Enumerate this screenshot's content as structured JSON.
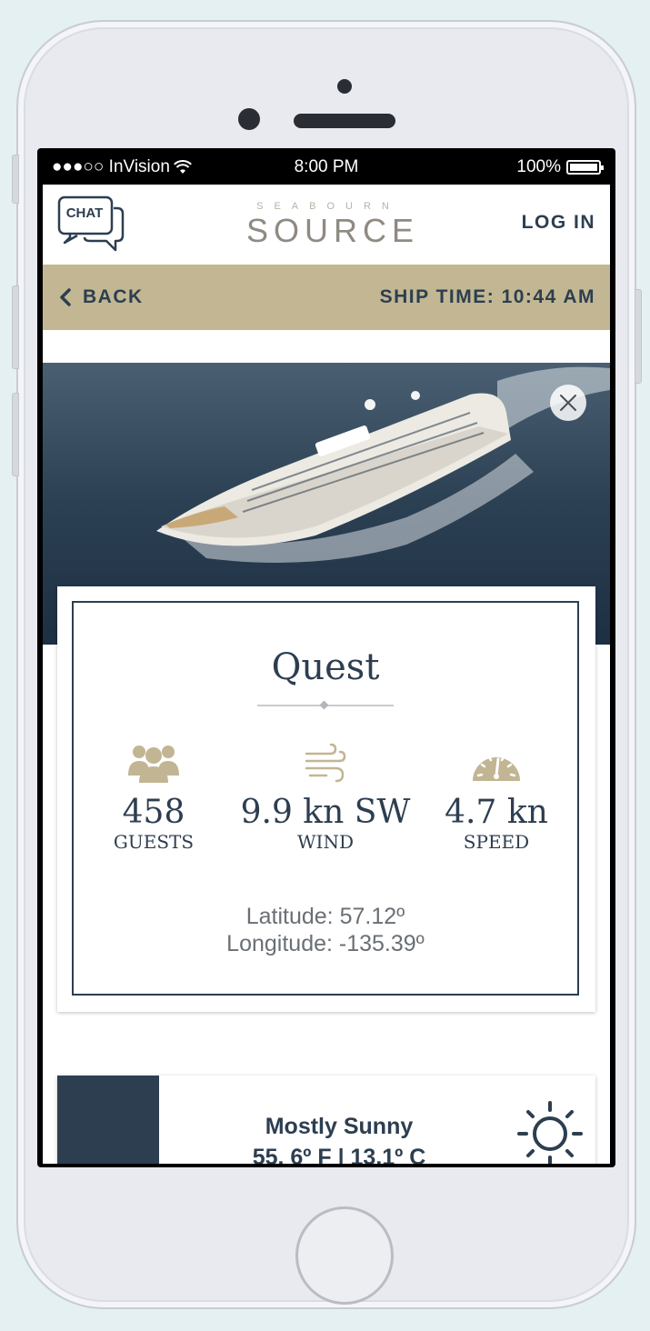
{
  "status_bar": {
    "carrier": "●●●○○ InVision",
    "time": "8:00 PM",
    "battery_percent": "100%"
  },
  "header": {
    "chat_label": "CHAT",
    "logo_top": "SEABOURN",
    "logo_main": "SOURCE",
    "logo_tm": "™",
    "login_label": "LOG IN"
  },
  "nav_bar": {
    "back_label": "BACK",
    "ship_time": "SHIP TIME: 10:44 AM",
    "background_color": "#c2b792"
  },
  "ship_card": {
    "name": "Quest",
    "stats": [
      {
        "icon": "guests-icon",
        "value": "458",
        "label": "GUESTS"
      },
      {
        "icon": "wind-icon",
        "value": "9.9 kn SW",
        "label": "WIND"
      },
      {
        "icon": "speedometer-icon",
        "value": "4.7 kn",
        "label": "SPEED"
      }
    ],
    "latitude": "Latitude: 57.12º",
    "longitude": "Longitude: -135.39º"
  },
  "weather": {
    "condition": "Mostly Sunny",
    "temperature": "55. 6º F | 13.1º C",
    "icon": "sun-icon"
  },
  "colors": {
    "accent_gold": "#c2b792",
    "navy": "#2d3e50",
    "icon_tan": "#c2b593"
  }
}
